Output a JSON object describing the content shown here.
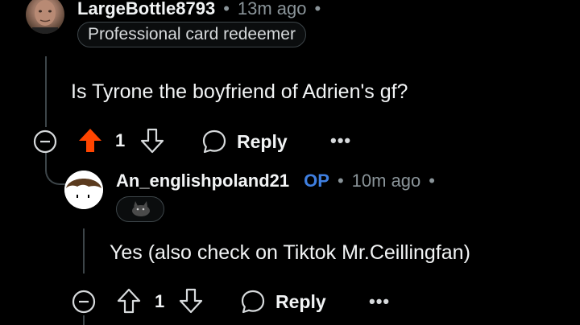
{
  "comment1": {
    "username": "LargeBottle8793",
    "time_ago": "13m ago",
    "flair": "Professional card redeemer",
    "body": "Is Tyrone the boyfriend of Adrien's gf?",
    "votes": "1",
    "reply_label": "Reply",
    "more_label": "•••",
    "upvoted": true
  },
  "comment2": {
    "username": "An_englishpoland21",
    "op_badge": "OP",
    "time_ago": "10m ago",
    "body": "Yes (also check on Tiktok Mr.Ceillingfan)",
    "votes": "1",
    "reply_label": "Reply",
    "more_label": "•••",
    "upvoted": false
  },
  "separator": "•",
  "colors": {
    "background": "#000000",
    "upvote_active": "#ff4500",
    "op_blue": "#3f7fe0",
    "meta_gray": "#8a9499"
  }
}
